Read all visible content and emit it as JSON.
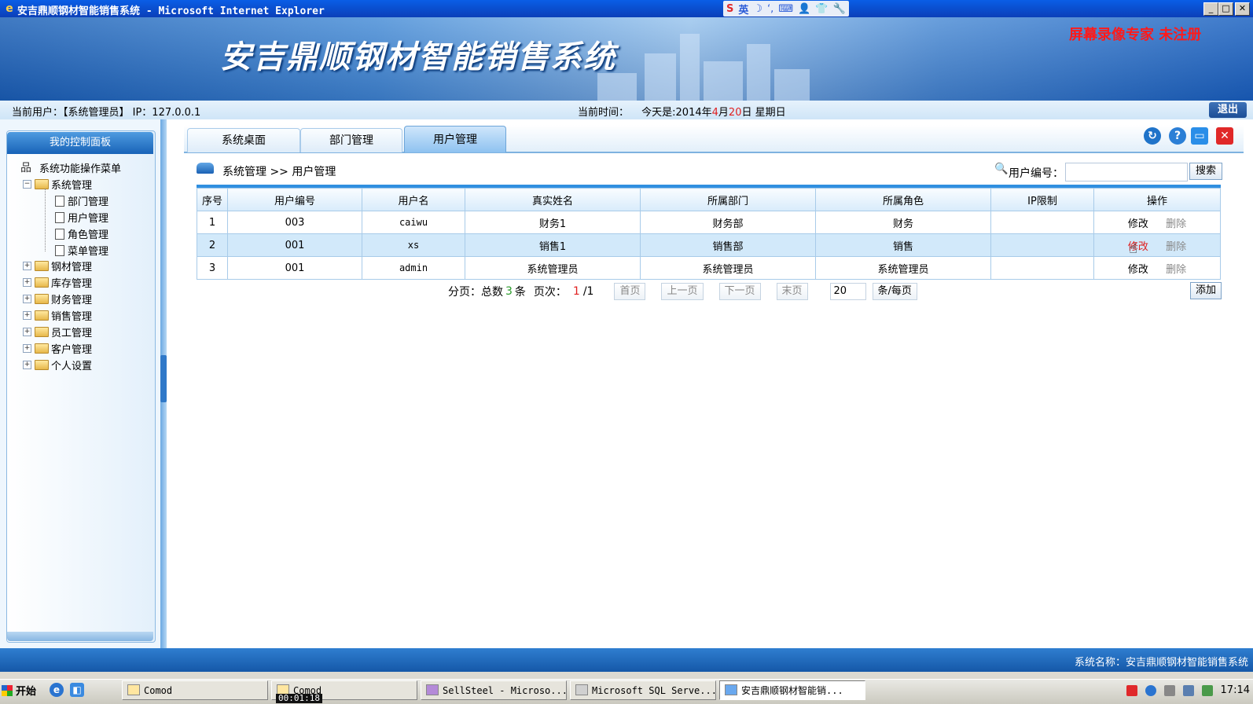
{
  "window": {
    "title": "安吉鼎顺钢材智能销售系统 - Microsoft Internet Explorer",
    "ime": {
      "s": "S",
      "lang": "英",
      "moon": "☽",
      "dot": "ʻ,",
      "kbd": "⌨",
      "user": "👤",
      "shirt": "👕",
      "wrench": "🔧"
    },
    "controls": {
      "minimize": "_",
      "maximize": "□",
      "close": "✕"
    }
  },
  "banner": {
    "system_name": "安吉鼎顺钢材智能销售系统",
    "watermark": "屏幕录像专家 未注册"
  },
  "infobar": {
    "user_info": "当前用户：【系统管理员】 IP：127.0.0.1",
    "time_label": "当前时间：",
    "time_prefix": "今天是:2014年",
    "month": "4",
    "month_suffix": "月",
    "day": "20",
    "day_suffix": "日 星期日",
    "logout": "退出"
  },
  "sidebar": {
    "title": "我的控制面板",
    "root": "系统功能操作菜单",
    "system_menu": {
      "label": "系统管理",
      "children": [
        "部门管理",
        "用户管理",
        "角色管理",
        "菜单管理"
      ]
    },
    "folders": [
      "钢材管理",
      "库存管理",
      "财务管理",
      "销售管理",
      "员工管理",
      "客户管理",
      "个人设置"
    ]
  },
  "tabs": [
    {
      "label": "系统桌面"
    },
    {
      "label": "部门管理"
    },
    {
      "label": "用户管理"
    }
  ],
  "breadcrumb": {
    "text": "系统管理 >> 用户管理"
  },
  "search": {
    "label": "用户编号：",
    "value": "",
    "button": "搜索"
  },
  "table": {
    "headers": [
      "序号",
      "用户编号",
      "用户名",
      "真实姓名",
      "所属部门",
      "所属角色",
      "IP限制",
      "操作"
    ],
    "rows": [
      {
        "index": "1",
        "code": "003",
        "username": "caiwu",
        "real_name": "财务1",
        "dept": "财务部",
        "role": "财务",
        "ip": "",
        "edit": "修改",
        "delete": "删除"
      },
      {
        "index": "2",
        "code": "001",
        "username": "xs",
        "real_name": "销售1",
        "dept": "销售部",
        "role": "销售",
        "ip": "",
        "edit": "修改",
        "delete": "删除"
      },
      {
        "index": "3",
        "code": "001",
        "username": "admin",
        "real_name": "系统管理员",
        "dept": "系统管理员",
        "role": "系统管理员",
        "ip": "",
        "edit": "修改",
        "delete": "删除"
      }
    ]
  },
  "pager": {
    "prefix": "分页：总数",
    "total": "3",
    "unit": "条",
    "page_label": "页次：",
    "page": "1",
    "page_total": "/1",
    "first": "首页",
    "prev": "上一页",
    "next": "下一页",
    "last": "末页",
    "page_size": "20",
    "per_page": "条/每页"
  },
  "add_button": "添加",
  "footer": "系统名称：安吉鼎顺钢材智能销售系统",
  "taskbar": {
    "start": "开始",
    "items": [
      {
        "label": "Comod"
      },
      {
        "label": "Comod"
      },
      {
        "label": "SellSteel - Microso..."
      },
      {
        "label": "Microsoft SQL Serve..."
      },
      {
        "label": "安吉鼎顺钢材智能销..."
      }
    ],
    "clock": "17:14",
    "record_time": "00:01:18"
  }
}
